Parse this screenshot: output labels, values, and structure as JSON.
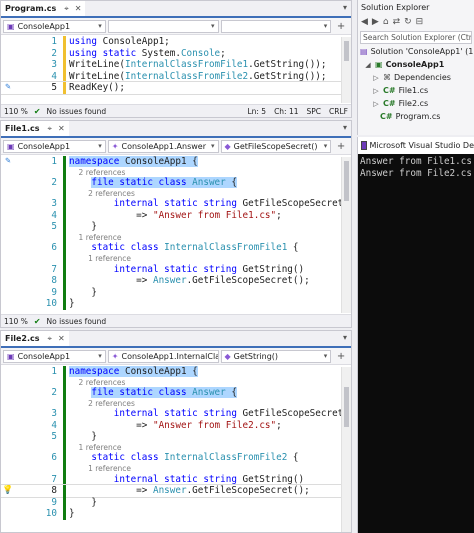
{
  "editors": [
    {
      "tab": "Program.cs",
      "nav": [
        "ConsoleApp1",
        "",
        ""
      ],
      "status": {
        "zoom": "110 %",
        "issues": "No issues found",
        "ln": "Ln: 5",
        "ch": "Ch: 11",
        "ws": "SPC",
        "eol": "CRLF"
      },
      "lines": [
        {
          "n": "1",
          "html": "<span class=\"kw\">using</span> ConsoleApp1;"
        },
        {
          "n": "2",
          "html": "<span class=\"kw\">using static</span> System.<span class=\"ty\">Console</span>;"
        },
        {
          "n": "3",
          "html": "WriteLine(<span class=\"ty\">InternalClassFromFile1</span>.GetString());"
        },
        {
          "n": "4",
          "html": "WriteLine(<span class=\"ty\">InternalClassFromFile2</span>.GetString());"
        },
        {
          "n": "5",
          "html": "ReadKey();"
        }
      ]
    },
    {
      "tab": "File1.cs",
      "nav": [
        "ConsoleApp1",
        "ConsoleApp1.Answer",
        "GetFileScopeSecret()"
      ],
      "status": {
        "zoom": "110 %",
        "issues": "No issues found"
      },
      "lines": [
        {
          "n": "1",
          "html": "<span class=\"hl\"><span class=\"kw\">namespace</span> ConsoleApp1 {</span>"
        },
        {
          "ref": "2 references"
        },
        {
          "n": "2",
          "html": "    <span class=\"hl\"><span class=\"kw\">file static class</span> <span class=\"ty\">Answer</span> {</span>"
        },
        {
          "ref": "2 references"
        },
        {
          "n": "3",
          "html": "        <span class=\"kw\">internal static string</span> GetFileScopeSecret()"
        },
        {
          "n": "4",
          "html": "            => <span class=\"st\">\"Answer from File1.cs\"</span>;"
        },
        {
          "n": "5",
          "html": "    }"
        },
        {
          "ref": "1 reference"
        },
        {
          "n": "6",
          "html": "    <span class=\"kw\">static class</span> <span class=\"ty\">InternalClassFromFile1</span> {"
        },
        {
          "ref": "1 reference"
        },
        {
          "n": "7",
          "html": "        <span class=\"kw\">internal static string</span> GetString()"
        },
        {
          "n": "8",
          "html": "            => <span class=\"ty\">Answer</span>.GetFileScopeSecret();"
        },
        {
          "n": "9",
          "html": "    }"
        },
        {
          "n": "10",
          "html": "}"
        }
      ]
    },
    {
      "tab": "File2.cs",
      "nav": [
        "ConsoleApp1",
        "ConsoleApp1.InternalCla",
        "GetString()"
      ],
      "lines": [
        {
          "n": "1",
          "html": "<span class=\"hl\"><span class=\"kw\">namespace</span> ConsoleApp1 {</span>"
        },
        {
          "ref": "2 references"
        },
        {
          "n": "2",
          "html": "    <span class=\"hl\"><span class=\"kw\">file static class</span> <span class=\"ty\">Answer</span> {</span>"
        },
        {
          "ref": "2 references"
        },
        {
          "n": "3",
          "html": "        <span class=\"kw\">internal static string</span> GetFileScopeSecret()"
        },
        {
          "n": "4",
          "html": "            => <span class=\"st\">\"Answer from File2.cs\"</span>;"
        },
        {
          "n": "5",
          "html": "    }"
        },
        {
          "ref": "1 reference"
        },
        {
          "n": "6",
          "html": "    <span class=\"kw\">static class</span> <span class=\"ty\">InternalClassFromFile2</span> {"
        },
        {
          "ref": "1 reference"
        },
        {
          "n": "7",
          "html": "        <span class=\"kw\">internal static string</span> GetString()"
        },
        {
          "n": "8",
          "html": "            => <span class=\"ty\">Answer</span>.GetFileScopeSecret();"
        },
        {
          "n": "9",
          "html": "    }"
        },
        {
          "n": "10",
          "html": "}"
        }
      ]
    }
  ],
  "solution_explorer": {
    "title": "Solution Explorer",
    "search_placeholder": "Search Solution Explorer (Ctrl+;)",
    "items": [
      {
        "label": "Solution 'ConsoleApp1' (1"
      },
      {
        "label": "ConsoleApp1"
      },
      {
        "label": "Dependencies"
      },
      {
        "label": "File1.cs"
      },
      {
        "label": "File2.cs"
      },
      {
        "label": "Program.cs"
      }
    ]
  },
  "console": {
    "title": "Microsoft Visual Studio De",
    "output": [
      "Answer from File1.cs",
      "Answer from File2.cs"
    ]
  }
}
